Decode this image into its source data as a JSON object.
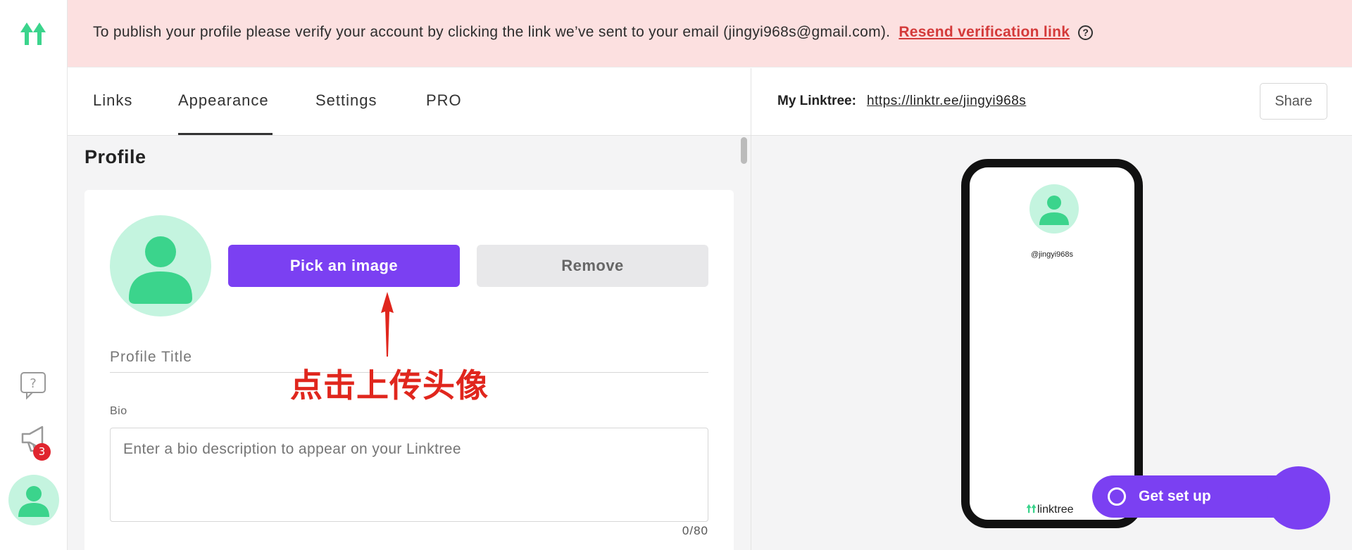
{
  "banner": {
    "message": "To publish your profile please verify your account by clicking the link we’ve sent to your email (jingyi968s@gmail.com).",
    "link_label": "Resend verification link",
    "help": "?"
  },
  "sidebar": {
    "notifications_badge": "3",
    "icons": [
      "linktree-logo-icon",
      "help-chat-icon",
      "megaphone-icon",
      "avatar-icon"
    ]
  },
  "tabs": [
    "Links",
    "Appearance",
    "Settings",
    "PRO"
  ],
  "active_tab": "Appearance",
  "profile": {
    "section_title": "Profile",
    "pick_label": "Pick an image",
    "remove_label": "Remove",
    "title_placeholder": "Profile Title",
    "bio_label": "Bio",
    "bio_placeholder": "Enter a bio description to appear on your Linktree",
    "bio_counter": "0/80"
  },
  "annotation": {
    "text": "点击上传头像"
  },
  "preview": {
    "label": "My Linktree:",
    "url": "https://linktr.ee/jingyi968s",
    "share_label": "Share",
    "handle": "@jingyi968s",
    "brand": "linktree",
    "get_set_up_label": "Get set up"
  },
  "colors": {
    "accent": "#7b40f2",
    "banner_bg": "#fce0e0",
    "link_red": "#d43a3a",
    "avatar_bg": "#c4f4df",
    "avatar_fg": "#3bd48c",
    "annotation_red": "#e0261d"
  }
}
